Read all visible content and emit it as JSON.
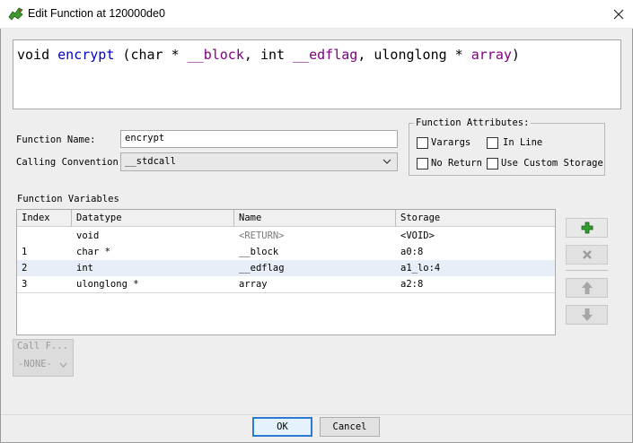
{
  "window": {
    "title": "Edit Function at 120000de0"
  },
  "signature": {
    "return_type": "void",
    "name": "encrypt",
    "open": "(",
    "params": [
      {
        "type": "char *",
        "name": "__block",
        "sep": ","
      },
      {
        "type": "int",
        "name": "__edflag",
        "sep": ","
      },
      {
        "type": "ulonglong *",
        "name": "array",
        "sep": ")"
      }
    ]
  },
  "form": {
    "function_name_label": "Function Name:",
    "function_name_value": "encrypt",
    "calling_convention_label": "Calling Convention",
    "calling_convention_value": "__stdcall"
  },
  "attributes": {
    "title": "Function Attributes:",
    "varargs": "Varargs",
    "inline": "In Line",
    "no_return": "No Return",
    "custom_storage": "Use Custom Storage"
  },
  "variables": {
    "title": "Function Variables",
    "columns": [
      "Index",
      "Datatype",
      "Name",
      "Storage"
    ],
    "rows": [
      {
        "index": "",
        "datatype": "void",
        "name": "<RETURN>",
        "storage": "<VOID>"
      },
      {
        "index": "1",
        "datatype": "char *",
        "name": "__block",
        "storage": "a0:8"
      },
      {
        "index": "2",
        "datatype": "int",
        "name": "__edflag",
        "storage": "a1_lo:4"
      },
      {
        "index": "3",
        "datatype": "ulonglong *",
        "name": "array",
        "storage": "a2:8"
      }
    ]
  },
  "call_fixup": {
    "label": "Call F...",
    "value": "-NONE-"
  },
  "buttons": {
    "ok": "OK",
    "cancel": "Cancel"
  }
}
